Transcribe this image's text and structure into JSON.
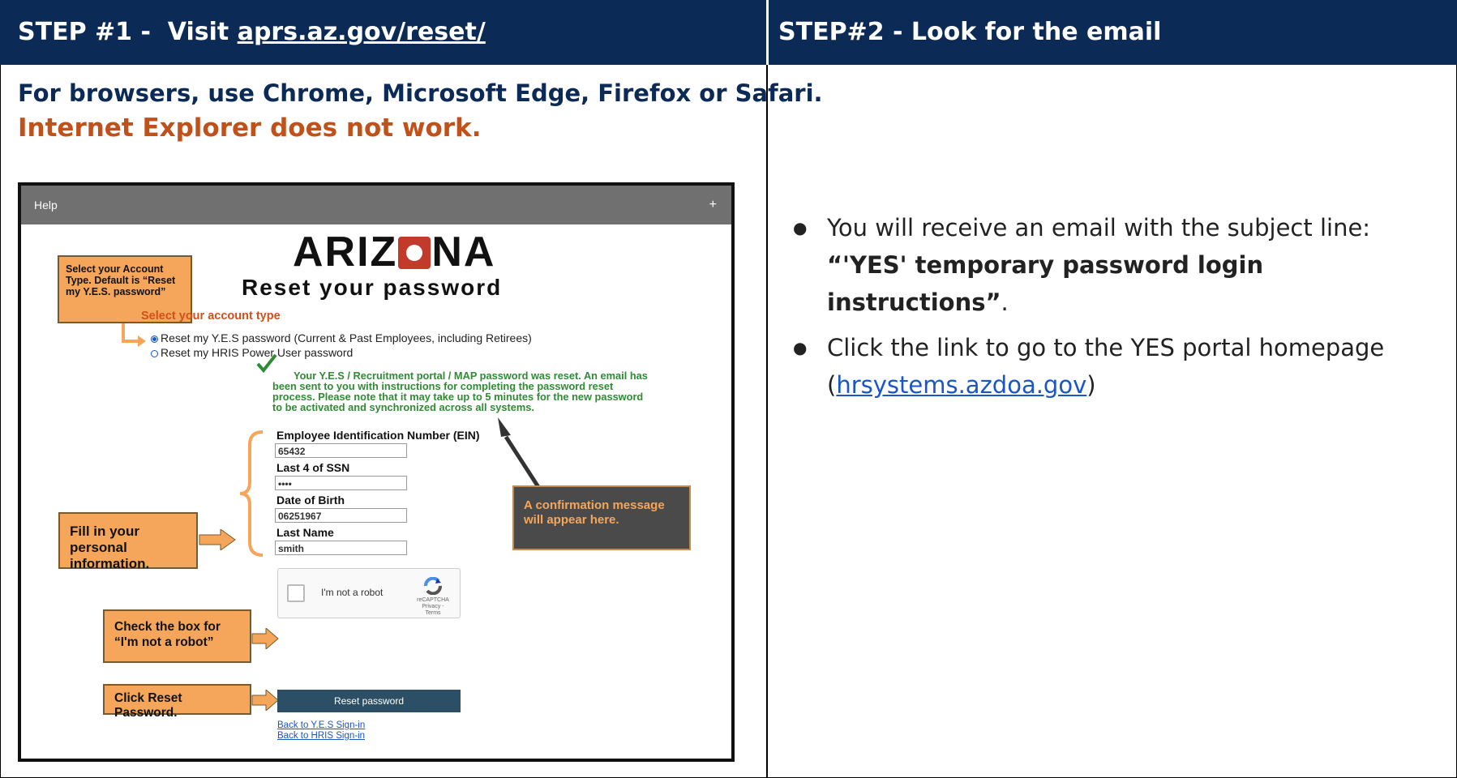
{
  "step1": {
    "prefix": "STEP #1 -  Visit ",
    "link": "aprs.az.gov/reset/"
  },
  "step2": {
    "title": "STEP#2 - Look for the email"
  },
  "intro": {
    "browsers": "For browsers, use Chrome, Microsoft Edge, Firefox or Safari.",
    "warning": "Internet Explorer does not work."
  },
  "shot": {
    "help": "Help",
    "plus": "+",
    "logo_left": "ARIZ",
    "logo_right": "NA",
    "reset_title": "Reset your password",
    "select_heading": "Select your account type",
    "radio1": "Reset my Y.E.S password (Current & Past Employees, including Retirees)",
    "radio2": "Reset my HRIS Power User password",
    "message": "Your Y.E.S / Recruitment portal / MAP password was reset. An email has been sent to you with instructions for completing the password reset process. Please note that it may take up to 5 minutes for the new password to be activated and synchronized across all systems.",
    "fields": {
      "ein_label": "Employee Identification Number (EIN)",
      "ein_value": "65432",
      "ssn_label": "Last 4 of SSN",
      "ssn_value": "••••",
      "dob_label": "Date of Birth",
      "dob_value": "06251967",
      "last_label": "Last Name",
      "last_value": "smith"
    },
    "captcha": {
      "label": "I'm not a robot",
      "brand": "reCAPTCHA",
      "links": "Privacy - Terms"
    },
    "reset_button": "Reset password",
    "link_yes": "Back to Y.E.S Sign-in",
    "link_hris": "Back to HRIS Sign-in",
    "callouts": {
      "account": "Select your Account Type. Default is “Reset my Y.E.S. password”",
      "personal": "Fill in your personal information.",
      "robot": "Check the box for “I'm not a robot”",
      "reset": "Click Reset Password.",
      "confirm": "A confirmation message will appear here."
    }
  },
  "right": {
    "b1_text": "You will receive an email with the subject line:",
    "b1_bold": "“'YES' temporary password login instructions”",
    "b1_end": ".",
    "b2_text": "Click the link to go to the YES portal homepage",
    "b2_open": "(",
    "b2_link": "hrsystems.azdoa.gov",
    "b2_close": ")"
  }
}
